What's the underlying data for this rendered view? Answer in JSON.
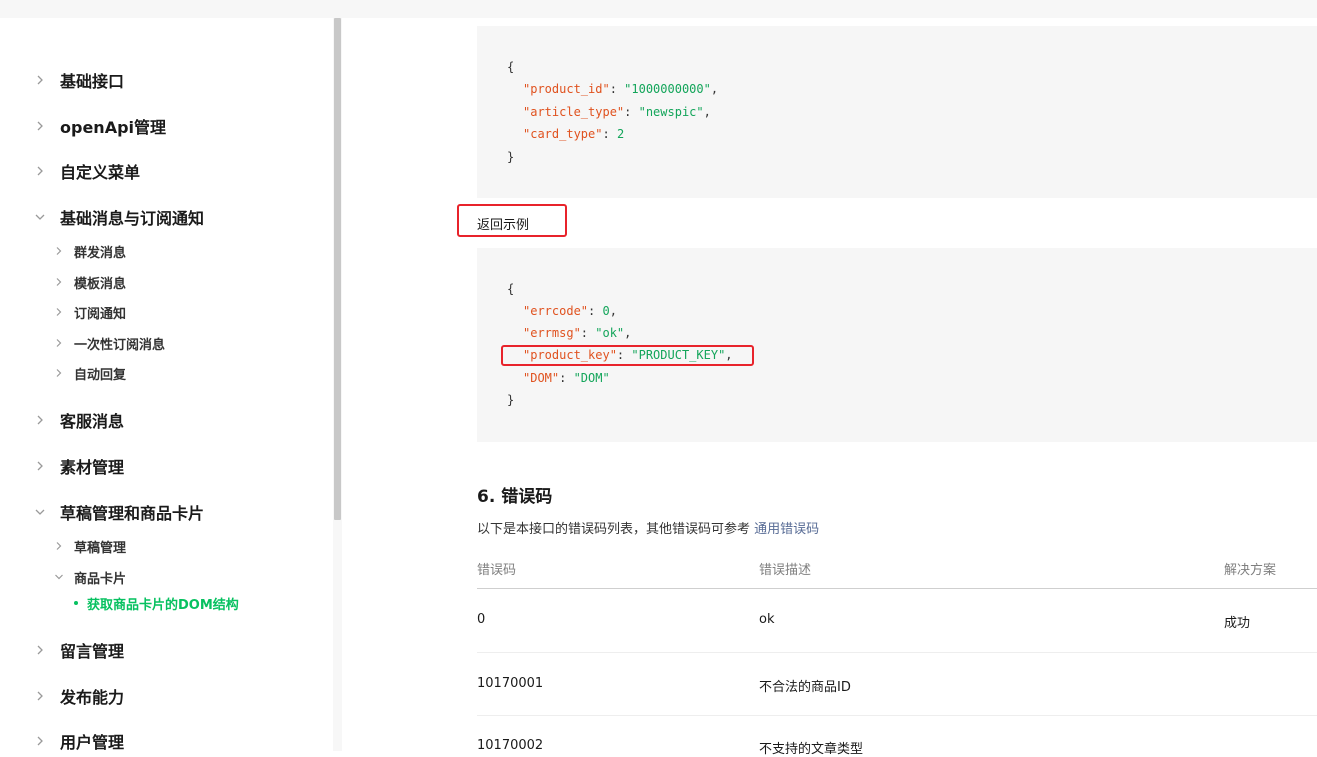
{
  "sidebar": {
    "items": [
      {
        "label": "基础接口",
        "expanded": false
      },
      {
        "label": "openApi管理",
        "expanded": false
      },
      {
        "label": "自定义菜单",
        "expanded": false
      },
      {
        "label": "基础消息与订阅通知",
        "expanded": true,
        "children": [
          "群发消息",
          "模板消息",
          "订阅通知",
          "一次性订阅消息",
          "自动回复"
        ]
      },
      {
        "label": "客服消息",
        "expanded": false
      },
      {
        "label": "素材管理",
        "expanded": false
      },
      {
        "label": "草稿管理和商品卡片",
        "expanded": true,
        "children": [
          "草稿管理",
          "商品卡片"
        ],
        "active_child": "获取商品卡片的DOM结构"
      },
      {
        "label": "留言管理",
        "expanded": false
      },
      {
        "label": "发布能力",
        "expanded": false
      },
      {
        "label": "用户管理",
        "expanded": false
      }
    ],
    "icons": {
      "collapsed": "chevron-right-icon",
      "expanded": "chevron-down-icon"
    }
  },
  "request_example": {
    "lines": [
      {
        "open": "{"
      },
      {
        "key": "\"product_id\"",
        "sep": ": ",
        "value": "\"1000000000\"",
        "end": ","
      },
      {
        "key": "\"article_type\"",
        "sep": ": ",
        "value": "\"newspic\"",
        "end": ","
      },
      {
        "key": "\"card_type\"",
        "sep": ": ",
        "value": "2",
        "end": ""
      },
      {
        "open": "}"
      }
    ]
  },
  "return_label": "返回示例",
  "response_example": {
    "lines": [
      {
        "open": "{"
      },
      {
        "key": "\"errcode\"",
        "sep": ": ",
        "value": "0",
        "end": ","
      },
      {
        "key": "\"errmsg\"",
        "sep": ": ",
        "value": "\"ok\"",
        "end": ","
      },
      {
        "key": "\"product_key\"",
        "sep": ": ",
        "value": "\"PRODUCT_KEY\"",
        "end": ","
      },
      {
        "key": "\"DOM\"",
        "sep": ": ",
        "value": "\"DOM\"",
        "end": ""
      },
      {
        "open": "}"
      }
    ]
  },
  "error_section": {
    "heading": "6. 错误码",
    "desc_text": "以下是本接口的错误码列表，其他错误码可参考 ",
    "desc_link": "通用错误码",
    "columns": [
      "错误码",
      "错误描述",
      "解决方案"
    ],
    "rows": [
      [
        "0",
        "ok",
        "成功"
      ],
      [
        "10170001",
        "不合法的商品ID",
        ""
      ],
      [
        "10170002",
        "不支持的文章类型",
        ""
      ]
    ]
  },
  "colors": {
    "accent_green": "#07c160",
    "annotation_red": "#e8232b",
    "link_blue": "#576b95",
    "code_key": "#e0521f",
    "code_string": "#13a55a"
  }
}
